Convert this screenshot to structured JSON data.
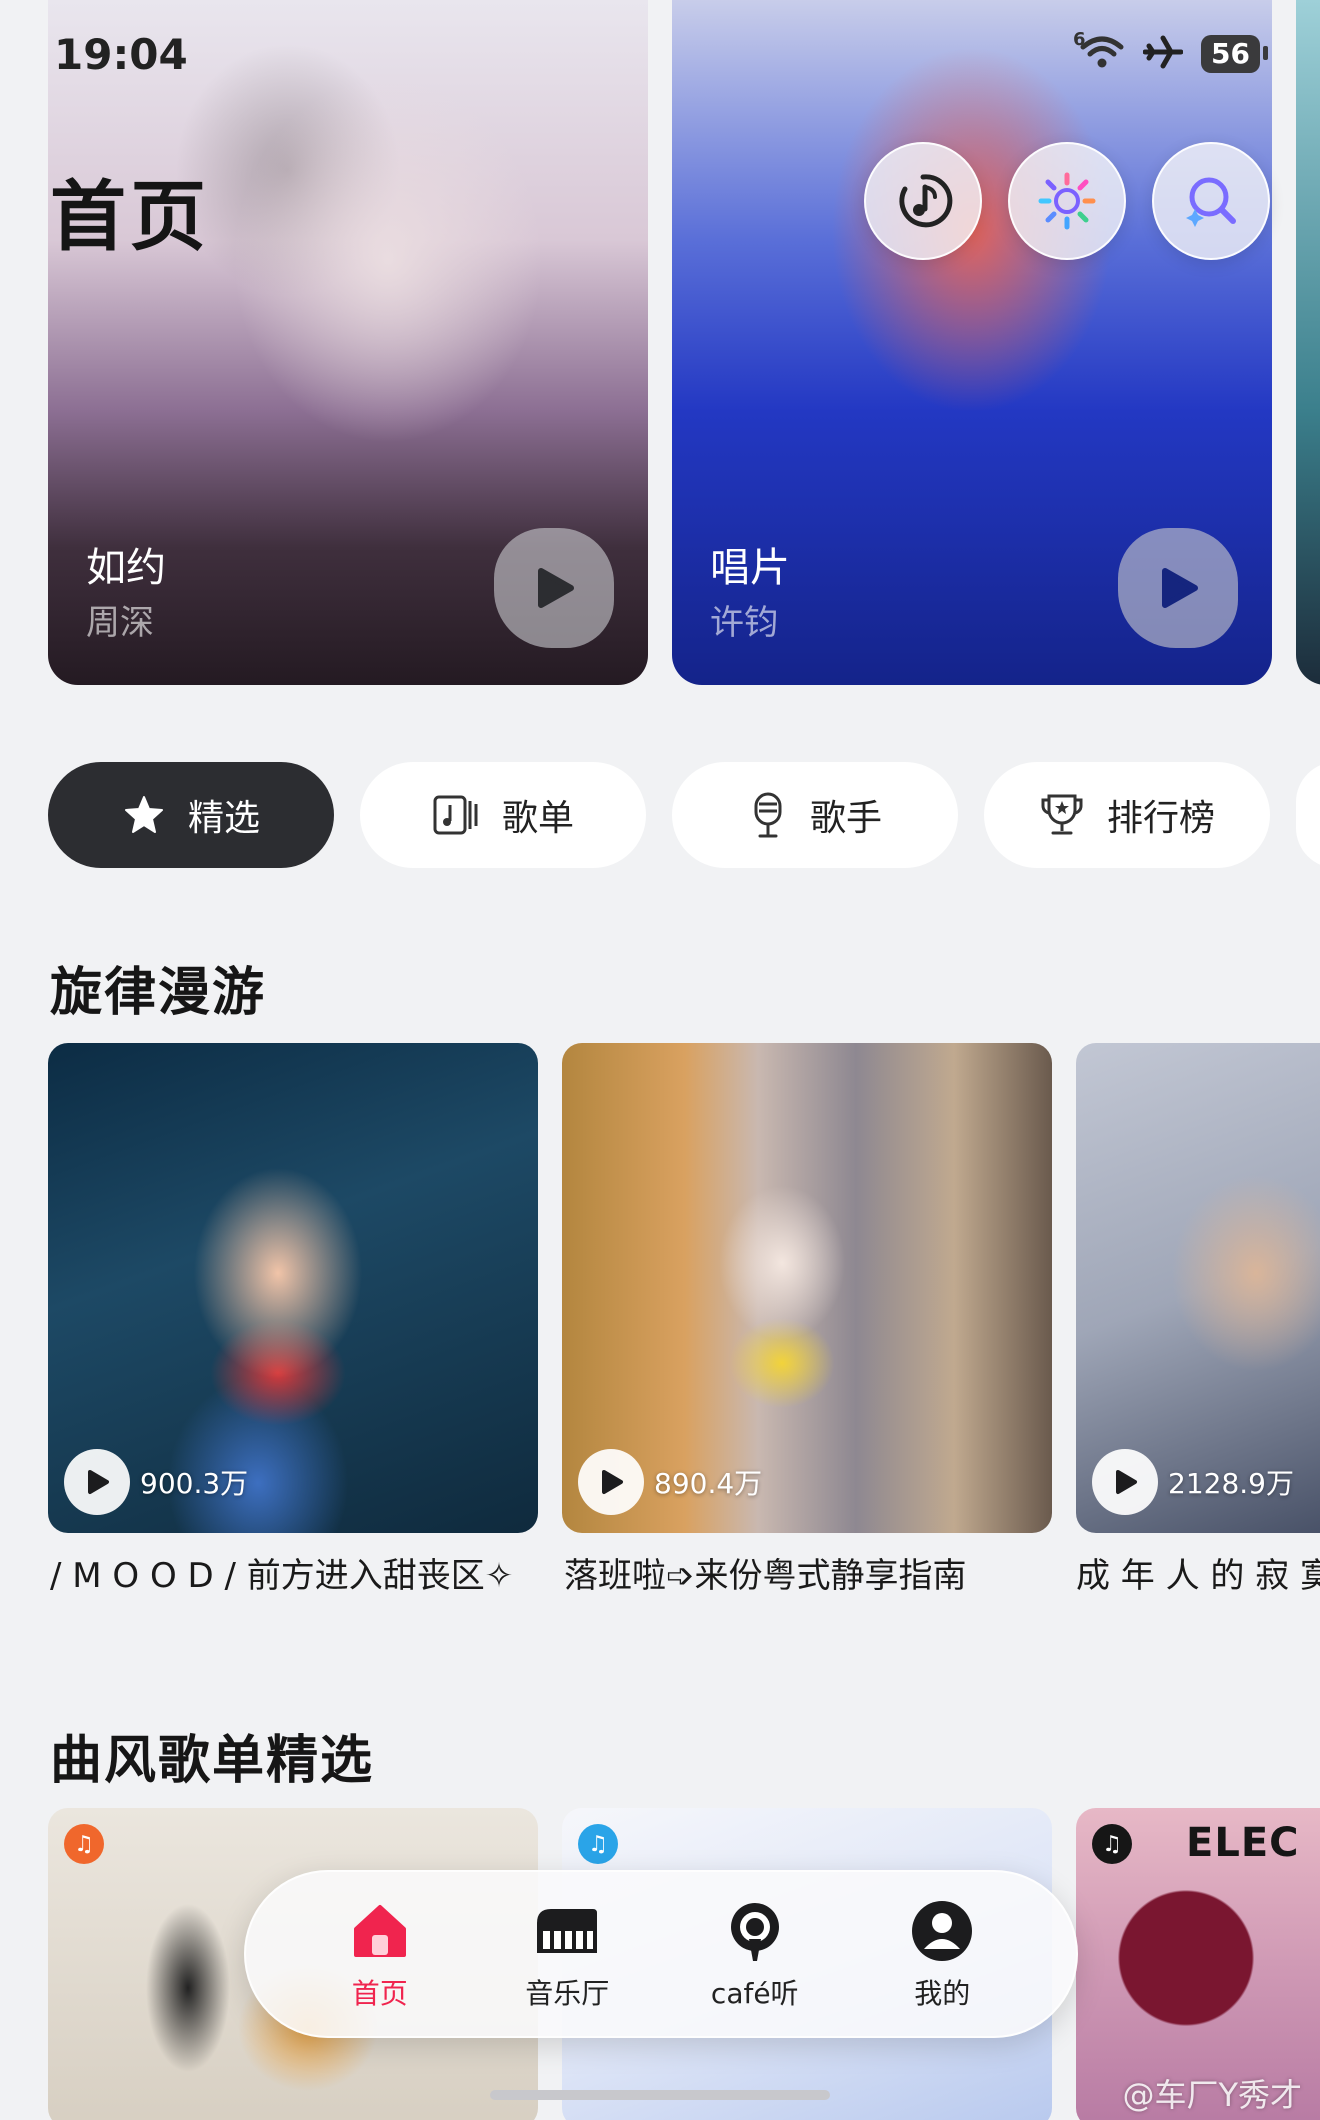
{
  "status_bar": {
    "time": "19:04",
    "network_label": "6",
    "battery": "56",
    "icons": [
      "wifi-icon",
      "airplane-icon",
      "battery-icon"
    ]
  },
  "header": {
    "title": "首页",
    "actions": [
      "recognize-music-icon",
      "sparkle-icon",
      "search-icon"
    ]
  },
  "hero": {
    "cards": [
      {
        "title": "如约",
        "artist": "周深"
      },
      {
        "title": "唱片",
        "artist": "许钧"
      }
    ]
  },
  "tabs": [
    {
      "label": "精选",
      "icon": "star-icon",
      "active": true
    },
    {
      "label": "歌单",
      "icon": "playlist-icon",
      "active": false
    },
    {
      "label": "歌手",
      "icon": "microphone-icon",
      "active": false
    },
    {
      "label": "排行榜",
      "icon": "trophy-icon",
      "active": false
    }
  ],
  "section1": {
    "title": "旋律漫游",
    "items": [
      {
        "count": "900.3万",
        "caption": "/ M O O D / 前方进入甜丧区✧"
      },
      {
        "count": "890.4万",
        "caption": "落班啦➩来份粤式静享指南"
      },
      {
        "count": "2128.9万",
        "caption": "成 年 人 的 寂 寞"
      }
    ]
  },
  "section2": {
    "title": "曲风歌单精选",
    "partial_label": "ELEC",
    "badge_colors": [
      "#f0672c",
      "#2aa4e8",
      "#161616"
    ]
  },
  "nav": {
    "items": [
      {
        "label": "首页",
        "icon": "home-icon",
        "active": true
      },
      {
        "label": "音乐厅",
        "icon": "piano-icon",
        "active": false
      },
      {
        "label": "café听",
        "icon": "podcast-icon",
        "active": false
      },
      {
        "label": "我的",
        "icon": "profile-icon",
        "active": false
      }
    ]
  },
  "watermark": "@车厂Y秀才",
  "colors": {
    "accent": "#f0244e",
    "active_chip": "#2c2d31",
    "background": "#f1f2f4"
  }
}
